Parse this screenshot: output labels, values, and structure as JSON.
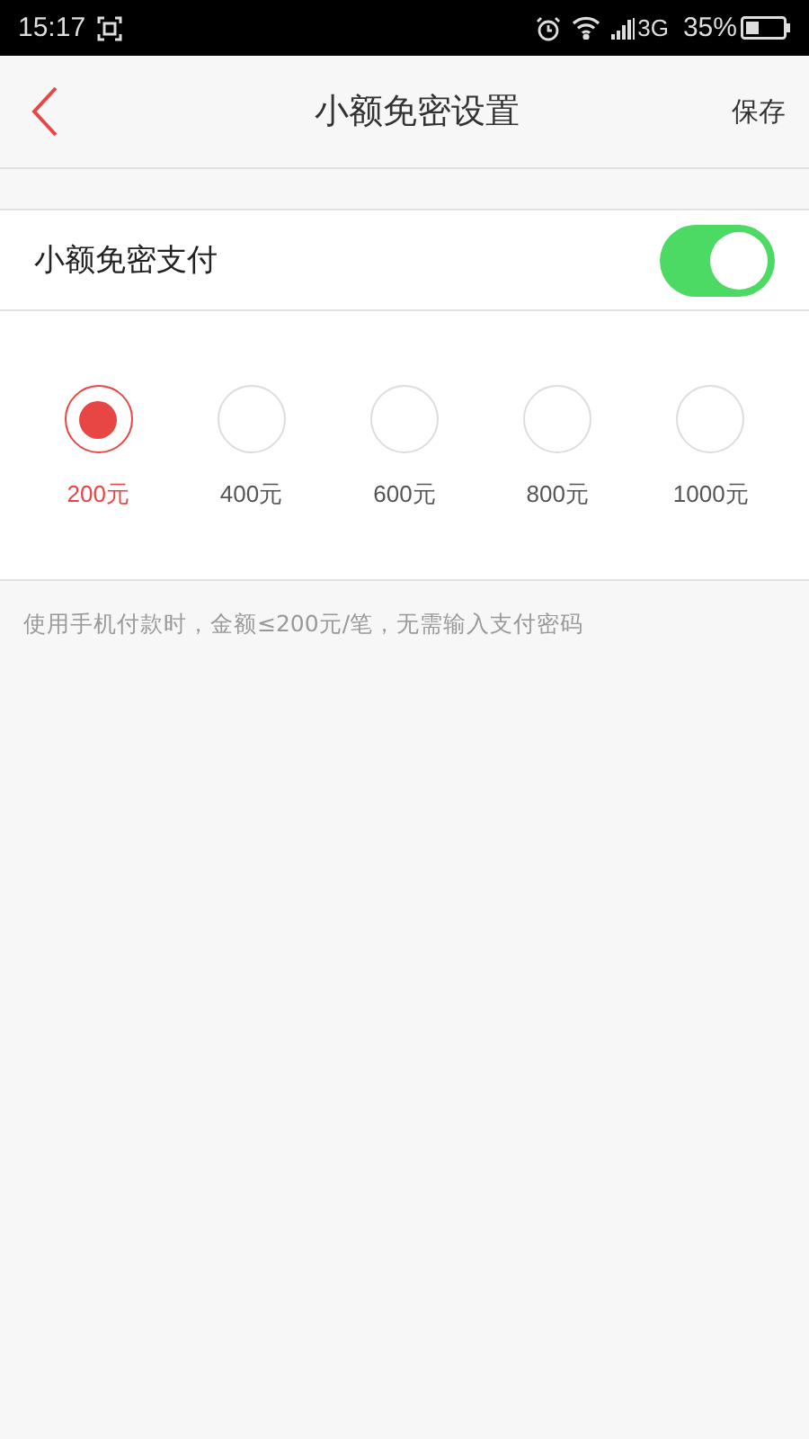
{
  "status_bar": {
    "time": "15:17",
    "network": "3G",
    "battery": "35%"
  },
  "header": {
    "title": "小额免密设置",
    "action": "保存"
  },
  "toggle": {
    "label": "小额免密支付",
    "on": true
  },
  "amounts": [
    {
      "label": "200元",
      "selected": true
    },
    {
      "label": "400元",
      "selected": false
    },
    {
      "label": "600元",
      "selected": false
    },
    {
      "label": "800元",
      "selected": false
    },
    {
      "label": "1000元",
      "selected": false
    }
  ],
  "note": "使用手机付款时，金额≤200元/笔，无需输入支付密码"
}
